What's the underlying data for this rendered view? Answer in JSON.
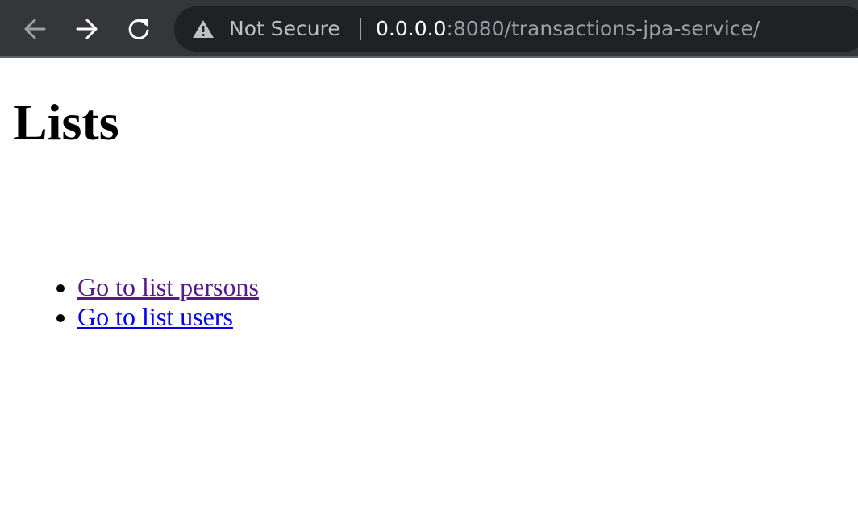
{
  "browser": {
    "security_label": "Not Secure",
    "url_host": "0.0.0.0",
    "url_path": ":8080/transactions-jpa-service/",
    "icons": {
      "back": "arrow-left-icon",
      "forward": "arrow-right-icon",
      "reload": "reload-icon",
      "security": "warning-icon"
    }
  },
  "page": {
    "heading": "Lists",
    "links": [
      {
        "label": "Go to list persons",
        "visited": true
      },
      {
        "label": "Go to list users",
        "visited": false
      }
    ]
  },
  "colors": {
    "toolbar_bg": "#35363a",
    "omnibox_bg": "#202124",
    "visited_link": "#551a8b",
    "unvisited_link": "#0000ee"
  }
}
